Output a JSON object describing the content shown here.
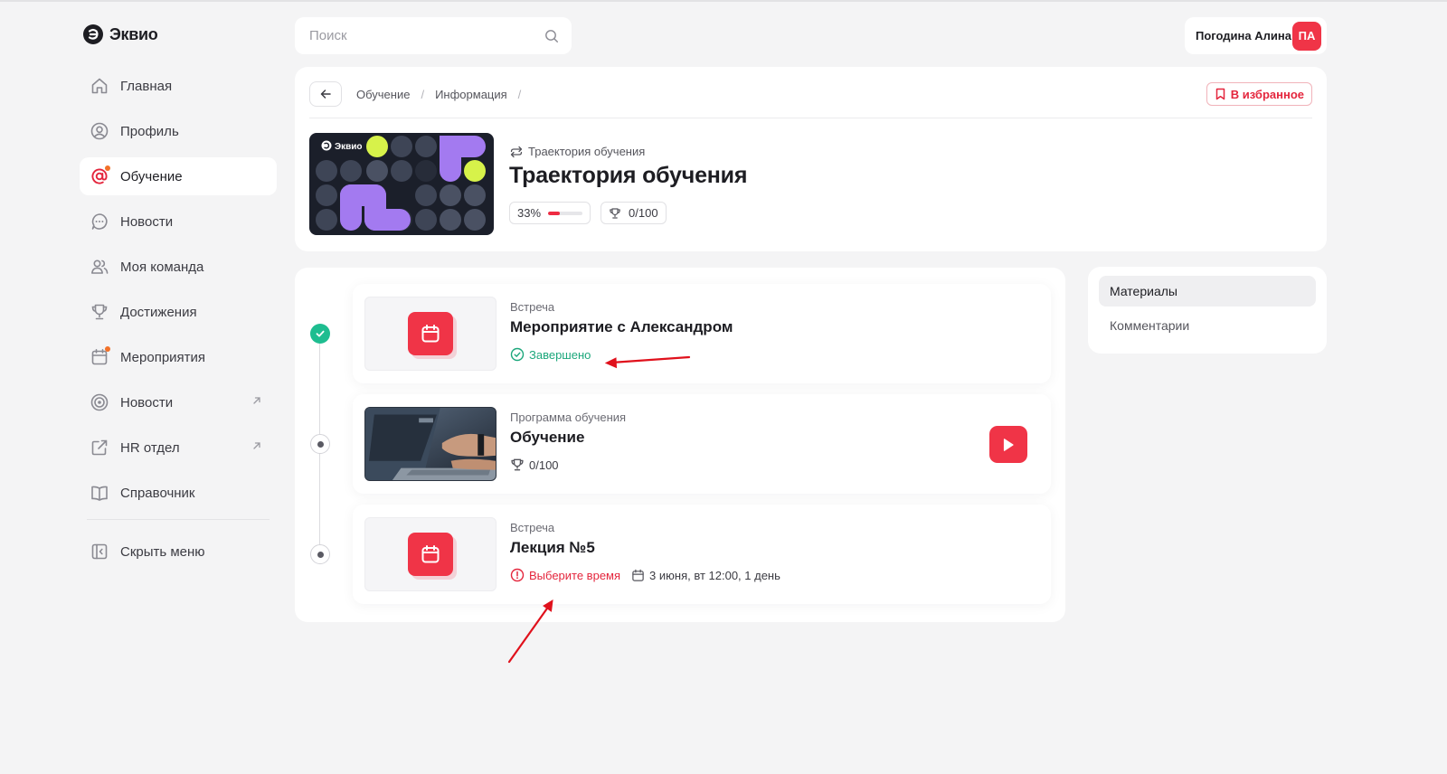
{
  "brand": {
    "name": "Эквио"
  },
  "search": {
    "placeholder": "Поиск",
    "value": ""
  },
  "user": {
    "name": "Погодина Алина",
    "initials": "ПА"
  },
  "sidebar": {
    "items": [
      {
        "label": "Главная",
        "icon": "home-icon",
        "active": false,
        "dot": false,
        "external": false
      },
      {
        "label": "Профиль",
        "icon": "user-circle-icon",
        "active": false,
        "dot": false,
        "external": false
      },
      {
        "label": "Обучение",
        "icon": "at-sign-icon",
        "active": true,
        "dot": true,
        "external": false
      },
      {
        "label": "Новости",
        "icon": "chat-bubble-icon",
        "active": false,
        "dot": false,
        "external": false
      },
      {
        "label": "Моя команда",
        "icon": "team-icon",
        "active": false,
        "dot": false,
        "external": false
      },
      {
        "label": "Достижения",
        "icon": "trophy-icon",
        "active": false,
        "dot": false,
        "external": false
      },
      {
        "label": "Мероприятия",
        "icon": "calendar-icon",
        "active": false,
        "dot": true,
        "external": false
      },
      {
        "label": "Новости",
        "icon": "target-icon",
        "active": false,
        "dot": false,
        "external": true
      },
      {
        "label": "HR отдел",
        "icon": "external-link-icon",
        "active": false,
        "dot": false,
        "external": true
      },
      {
        "label": "Справочник",
        "icon": "book-icon",
        "active": false,
        "dot": false,
        "external": false
      }
    ],
    "collapse_label": "Скрыть меню"
  },
  "breadcrumb": [
    "Обучение",
    "Информация"
  ],
  "favorite_label": "В избранное",
  "course": {
    "type_label": "Траектория обучения",
    "title": "Траектория обучения",
    "progress_text": "33%",
    "progress": 0.33,
    "score": "0/100",
    "cover_logo": "Эквио"
  },
  "materials": [
    {
      "kind": "Встреча",
      "title": "Мероприятие с Александром",
      "status": "done",
      "status_text": "Завершено"
    },
    {
      "kind": "Программа обучения",
      "title": "Обучение",
      "status": "pending",
      "score": "0/100"
    },
    {
      "kind": "Встреча",
      "title": "Лекция №5",
      "status": "pending",
      "warning_text": "Выберите время",
      "date_text": "3 июня, вт 12:00, 1 день"
    }
  ],
  "side_tabs": [
    {
      "label": "Материалы",
      "active": true
    },
    {
      "label": "Комментарии",
      "active": false
    }
  ],
  "colors": {
    "accent": "#f03447",
    "success": "#1ebd90",
    "purple": "#a37af0",
    "lime": "#d7f24a",
    "cover_bg": "#1b1f2a"
  }
}
